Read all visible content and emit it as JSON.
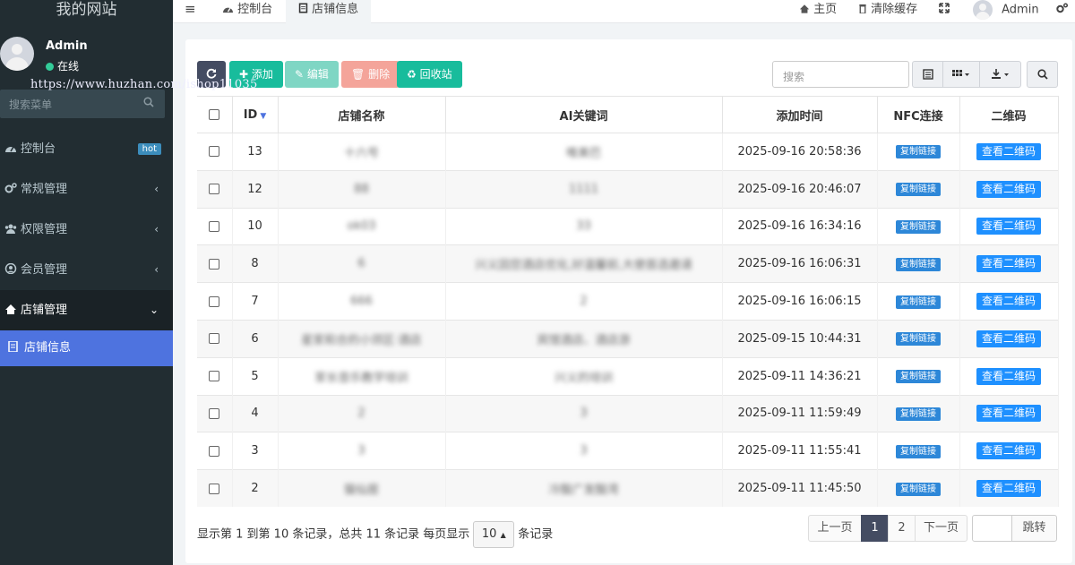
{
  "sidebar": {
    "logo": "我的网站",
    "user": {
      "name": "Admin",
      "status": "在线"
    },
    "watermark": "https://www.huzhan.com/ishop11035",
    "search_placeholder": "搜索菜单",
    "items": [
      {
        "label": "控制台",
        "icon": "dashboard-icon",
        "badge": "hot"
      },
      {
        "label": "常规管理",
        "icon": "cogs-icon",
        "arrow": "‹"
      },
      {
        "label": "权限管理",
        "icon": "group-icon",
        "arrow": "‹"
      },
      {
        "label": "会员管理",
        "icon": "user-circle-icon",
        "arrow": "‹"
      },
      {
        "label": "店铺管理",
        "icon": "home-icon",
        "arrow": "⌄"
      },
      {
        "label": "店铺信息",
        "icon": "file-icon"
      }
    ]
  },
  "topbar": {
    "menu_icon": "bars-icon",
    "tabs": [
      {
        "label": "控制台",
        "icon": "dashboard-icon"
      },
      {
        "label": "店铺信息",
        "icon": "file-icon"
      }
    ],
    "home": "主页",
    "clear_cache": "清除缓存",
    "user": "Admin"
  },
  "toolbar": {
    "refresh_icon": "refresh-icon",
    "add": "添加",
    "edit": "编辑",
    "delete": "删除",
    "recycle": "回收站",
    "search_placeholder": "搜索"
  },
  "colors": {
    "sidebar_bg": "#222d32",
    "active_blue": "#4e73df",
    "add_green": "#18bc9c",
    "delete_red": "#f27b6b",
    "refresh_dark": "#444c62"
  },
  "table": {
    "headers": {
      "id": "ID",
      "name": "店铺名称",
      "keywords": "AI关键词",
      "time": "添加时间",
      "nfc": "NFC连接",
      "qrcode": "二维码"
    },
    "nfc_label": "复制链接",
    "qr_label": "查看二维码",
    "rows": [
      {
        "id": "13",
        "name": "十六号",
        "keywords": "唯美巴",
        "time": "2025-09-16 20:58:36"
      },
      {
        "id": "12",
        "name": "88",
        "keywords": "1111",
        "time": "2025-09-16 20:46:07"
      },
      {
        "id": "10",
        "name": "ok03",
        "keywords": "33",
        "time": "2025-09-16 16:34:16"
      },
      {
        "id": "8",
        "name": "6",
        "keywords": "兴义因您酒店优化,好温馨前,大使首选邀请",
        "time": "2025-09-16 16:06:31"
      },
      {
        "id": "7",
        "name": "666",
        "keywords": "2",
        "time": "2025-09-16 16:06:15"
      },
      {
        "id": "6",
        "name": "星家和合的小郊区·酒店",
        "keywords": "宾馆酒店、酒店游",
        "time": "2025-09-15 10:44:31"
      },
      {
        "id": "5",
        "name": "家长音乐教学培训",
        "keywords": "兴义的培训",
        "time": "2025-09-11 14:36:21"
      },
      {
        "id": "4",
        "name": "2",
        "keywords": "3",
        "time": "2025-09-11 11:59:49"
      },
      {
        "id": "3",
        "name": "3",
        "keywords": "3",
        "time": "2025-09-11 11:55:41"
      },
      {
        "id": "2",
        "name": "猫仙居",
        "keywords": "冷酸广发酸湾",
        "time": "2025-09-11 11:45:50"
      }
    ]
  },
  "pagination": {
    "info": "显示第 1 到第 10 条记录，总共 11 条记录 每页显示",
    "page_size": "10",
    "suffix": "条记录",
    "prev": "上一页",
    "p1": "1",
    "p2": "2",
    "next": "下一页",
    "jump": "跳转"
  }
}
